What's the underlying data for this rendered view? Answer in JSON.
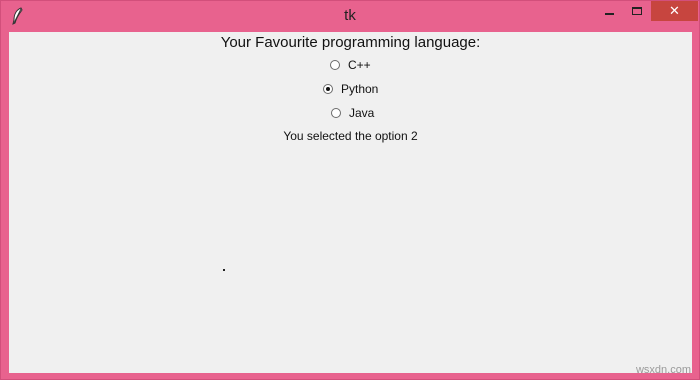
{
  "window": {
    "title": "tk",
    "icon": "feather-icon",
    "frame_color": "#e8628e",
    "close_color": "#c7453f"
  },
  "controls": {
    "minimize": "minimize-icon",
    "maximize": "maximize-icon",
    "close": "close-icon",
    "close_glyph": "✕"
  },
  "form": {
    "heading": "Your Favourite programming language:",
    "options": [
      {
        "label": "C++",
        "selected": false
      },
      {
        "label": "Python",
        "selected": true
      },
      {
        "label": "Java",
        "selected": false
      }
    ],
    "status": "You selected the option 2"
  },
  "watermark": "wsxdn.com"
}
